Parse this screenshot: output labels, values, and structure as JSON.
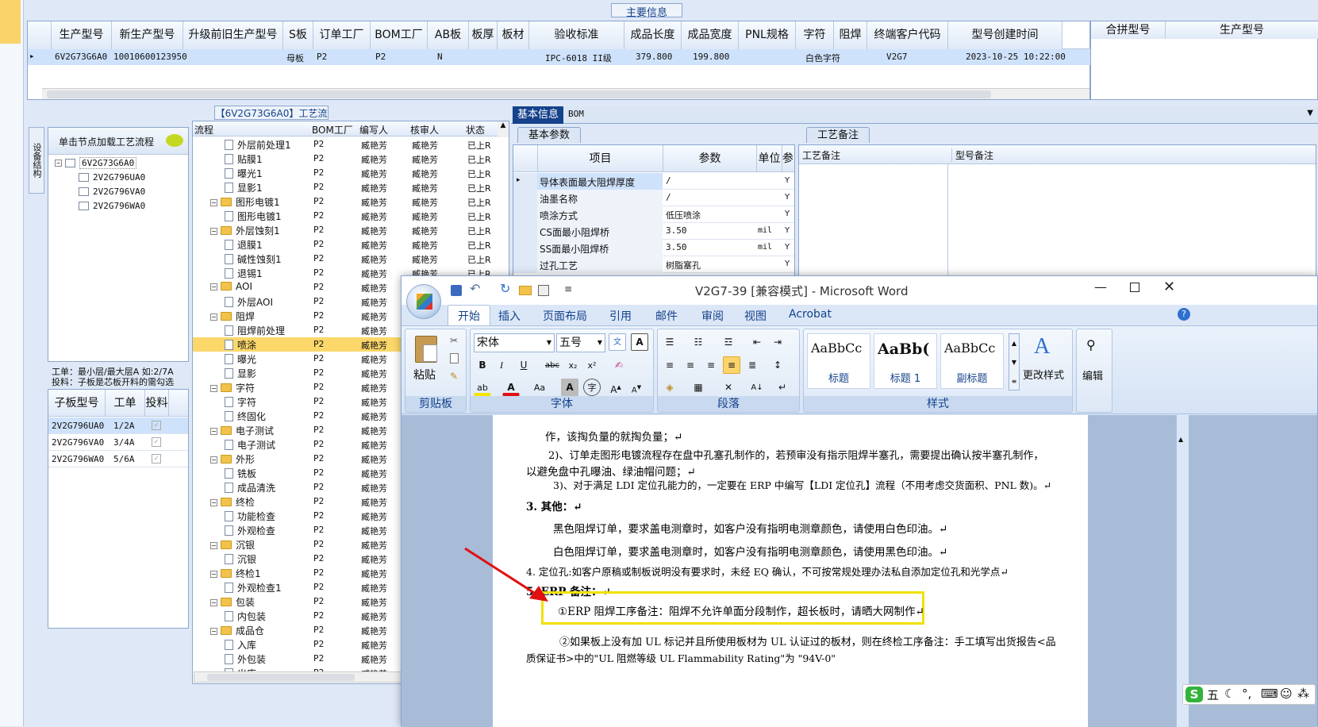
{
  "main_info": {
    "group_title": "主要信息",
    "columns": [
      "生产型号",
      "新生产型号",
      "升级前旧生产型号",
      "S板",
      "订单工厂",
      "BOM工厂",
      "AB板",
      "板厚",
      "板材",
      "验收标准",
      "成品长度",
      "成品宽度",
      "PNL规格",
      "字符",
      "阻焊",
      "终端客户代码",
      "型号创建时间"
    ],
    "row": {
      "prod": "6V2G73G6A0",
      "new": "10010600123950",
      "s": "母板",
      "order_factory": "P2",
      "bom_factory": "P2",
      "ab": "N",
      "standard": "IPC-6018 II级",
      "length": "379.800",
      "width": "199.800",
      "char": "白色字符",
      "customer": "V2G7",
      "created": "2023-10-25 10:22:00"
    },
    "merge_columns": [
      "合拼型号",
      "生产型号"
    ]
  },
  "process": {
    "title": "【6V2G73G6A0】工艺流程",
    "side_tab": "设备结构",
    "load_hint": "单击节点加载工艺流程",
    "tree_root": "6V2G73G6A0",
    "tree_children": [
      "2V2G796UA0",
      "2V2G796VA0",
      "2V2G796WA0"
    ],
    "info_line1": "工单：最小层/最大层A 如:2/7A",
    "info_line2": "投料：子板是芯板开料的需勾选",
    "sub_columns": [
      "子板型号",
      "工单",
      "投料"
    ],
    "sub_rows": [
      {
        "model": "2V2G796UA0",
        "order": "1/2A"
      },
      {
        "model": "2V2G796VA0",
        "order": "3/4A"
      },
      {
        "model": "2V2G796WA0",
        "order": "5/6A"
      }
    ],
    "flow_columns": [
      "流程",
      "BOM工厂",
      "编写人",
      "核审人",
      "状态"
    ],
    "flow_rows": [
      {
        "name": "外层前处理1",
        "level": 2,
        "folder": false
      },
      {
        "name": "贴膜1",
        "level": 2,
        "folder": false
      },
      {
        "name": "曝光1",
        "level": 2,
        "folder": false
      },
      {
        "name": "显影1",
        "level": 2,
        "folder": false
      },
      {
        "name": "图形电镀1",
        "level": 1,
        "folder": true
      },
      {
        "name": "图形电镀1",
        "level": 2,
        "folder": false
      },
      {
        "name": "外层蚀刻1",
        "level": 1,
        "folder": true
      },
      {
        "name": "退膜1",
        "level": 2,
        "folder": false
      },
      {
        "name": "碱性蚀刻1",
        "level": 2,
        "folder": false
      },
      {
        "name": "退锡1",
        "level": 2,
        "folder": false
      },
      {
        "name": "AOI",
        "level": 1,
        "folder": true
      },
      {
        "name": "外层AOI",
        "level": 2,
        "folder": false
      },
      {
        "name": "阻焊",
        "level": 1,
        "folder": true
      },
      {
        "name": "阻焊前处理",
        "level": 2,
        "folder": false
      },
      {
        "name": "喷涂",
        "level": 2,
        "folder": false,
        "selected": true
      },
      {
        "name": "曝光",
        "level": 2,
        "folder": false
      },
      {
        "name": "显影",
        "level": 2,
        "folder": false
      },
      {
        "name": "字符",
        "level": 1,
        "folder": true
      },
      {
        "name": "字符",
        "level": 2,
        "folder": false
      },
      {
        "name": "终固化",
        "level": 2,
        "folder": false
      },
      {
        "name": "电子测试",
        "level": 1,
        "folder": true
      },
      {
        "name": "电子测试",
        "level": 2,
        "folder": false
      },
      {
        "name": "外形",
        "level": 1,
        "folder": true
      },
      {
        "name": "铣板",
        "level": 2,
        "folder": false
      },
      {
        "name": "成品清洗",
        "level": 2,
        "folder": false
      },
      {
        "name": "终检",
        "level": 1,
        "folder": true
      },
      {
        "name": "功能检查",
        "level": 2,
        "folder": false
      },
      {
        "name": "外观检查",
        "level": 2,
        "folder": false
      },
      {
        "name": "沉银",
        "level": 1,
        "folder": true
      },
      {
        "name": "沉银",
        "level": 2,
        "folder": false
      },
      {
        "name": "终检1",
        "level": 1,
        "folder": true
      },
      {
        "name": "外观检查1",
        "level": 2,
        "folder": false
      },
      {
        "name": "包装",
        "level": 1,
        "folder": true
      },
      {
        "name": "内包装",
        "level": 2,
        "folder": false
      },
      {
        "name": "成品仓",
        "level": 1,
        "folder": true
      },
      {
        "name": "入库",
        "level": 2,
        "folder": false
      },
      {
        "name": "外包装",
        "level": 2,
        "folder": false
      },
      {
        "name": "出库",
        "level": 2,
        "folder": false
      }
    ],
    "bom": "P2",
    "writer": "臧艳芳",
    "reviewer": "臧艳芳",
    "status": "已上R"
  },
  "basic": {
    "tabs": [
      "基本信息",
      "BOM"
    ],
    "sub_tab": "基本参数",
    "columns": [
      "项目",
      "参数",
      "单位",
      "参"
    ],
    "rows": [
      {
        "item": "导体表面最大阻焊厚度",
        "param": "/",
        "unit": "",
        "flag": "Y"
      },
      {
        "item": "油墨名称",
        "param": "/",
        "unit": "",
        "flag": "Y"
      },
      {
        "item": "喷涂方式",
        "param": "低压喷涂",
        "unit": "",
        "flag": "Y"
      },
      {
        "item": "CS面最小阻焊桥",
        "param": "3.50",
        "unit": "mil",
        "flag": "Y"
      },
      {
        "item": "SS面最小阻焊桥",
        "param": "3.50",
        "unit": "mil",
        "flag": "Y"
      },
      {
        "item": "过孔工艺",
        "param": "树脂塞孔",
        "unit": "",
        "flag": "Y"
      }
    ],
    "notes_tab": "工艺备注",
    "notes_columns": [
      "工艺备注",
      "型号备注"
    ]
  },
  "word": {
    "title": "V2G7-39 [兼容模式] - Microsoft Word",
    "ribbon_tabs": [
      "开始",
      "插入",
      "页面布局",
      "引用",
      "邮件",
      "审阅",
      "视图",
      "Acrobat"
    ],
    "font_name": "宋体",
    "font_size": "五号",
    "paste_label": "粘贴",
    "groups": [
      "剪贴板",
      "字体",
      "段落",
      "样式",
      "编辑"
    ],
    "styles": [
      {
        "preview": "AaBbCc",
        "name": "标题"
      },
      {
        "preview": "AaBb(",
        "name": "标题 1"
      },
      {
        "preview": "AaBbCc",
        "name": "副标题"
      }
    ],
    "change_style": "更改样式",
    "edit": "编辑",
    "doc_lines": [
      "作，该掏负量的就掏负量；↵",
      "2)、订单走图形电镀流程存在盘中孔塞孔制作的，若预审没有指示阻焊半塞孔，需要提出确认按半塞孔制作，",
      "以避免盘中孔曝油、绿油帽问题；↵",
      "3)、对于满足 LDI 定位孔能力的，一定要在 ERP 中编写【LDI 定位孔】流程（不用考虑交货面积、PNL 数)。↵",
      "3. 其他：↵",
      "黑色阻焊订单，要求盖电测章时，如客户没有指明电测章颜色，请使用白色印油。↵",
      "白色阻焊订单，要求盖电测章时，如客户没有指明电测章颜色，请使用黑色印油。↵",
      "4. 定位孔:如客户原稿或制板说明没有要求时，未经 EQ 确认，不可按常规处理办法私自添加定位孔和光学点↵",
      "5. ERP 备注：↵",
      "①ERP 阻焊工序备注：阻焊不允许单面分段制作，超长板时，请晒大网制作↵",
      "②如果板上没有加 UL 标记并且所使用板材为 UL 认证过的板材，则在终检工序备注：手工填写出货报告<品",
      "质保证书>中的\"UL 阻燃等级 UL Flammability Rating\"为 \"94V-0\""
    ]
  },
  "ime": {
    "label": "五"
  },
  "colors": {
    "highlight_box": "#f0e000",
    "arrow": "#e01010",
    "selection": "#fcd86a",
    "ribbon": "#dbe7f7"
  }
}
